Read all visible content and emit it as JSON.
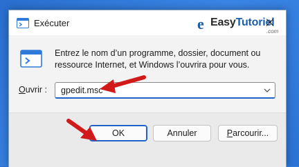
{
  "window": {
    "title": "Exécuter",
    "close_label": "✕"
  },
  "watermark": {
    "logo": "e",
    "name_part1": "Easy",
    "name_part2": "Tutoriel",
    "domain": ".com"
  },
  "content": {
    "description": "Entrez le nom d’un programme, dossier, document ou ressource Internet, et Windows l’ouvrira pour vous.",
    "open_label_prefix": "O",
    "open_label_rest": "uvrir :",
    "combo_value": "gpedit.msc"
  },
  "buttons": {
    "ok": "OK",
    "cancel": "Annuler",
    "browse_prefix": "P",
    "browse_rest": "arcourir..."
  },
  "colors": {
    "annotation_arrow": "#d11a1a",
    "accent": "#1e62c9"
  }
}
